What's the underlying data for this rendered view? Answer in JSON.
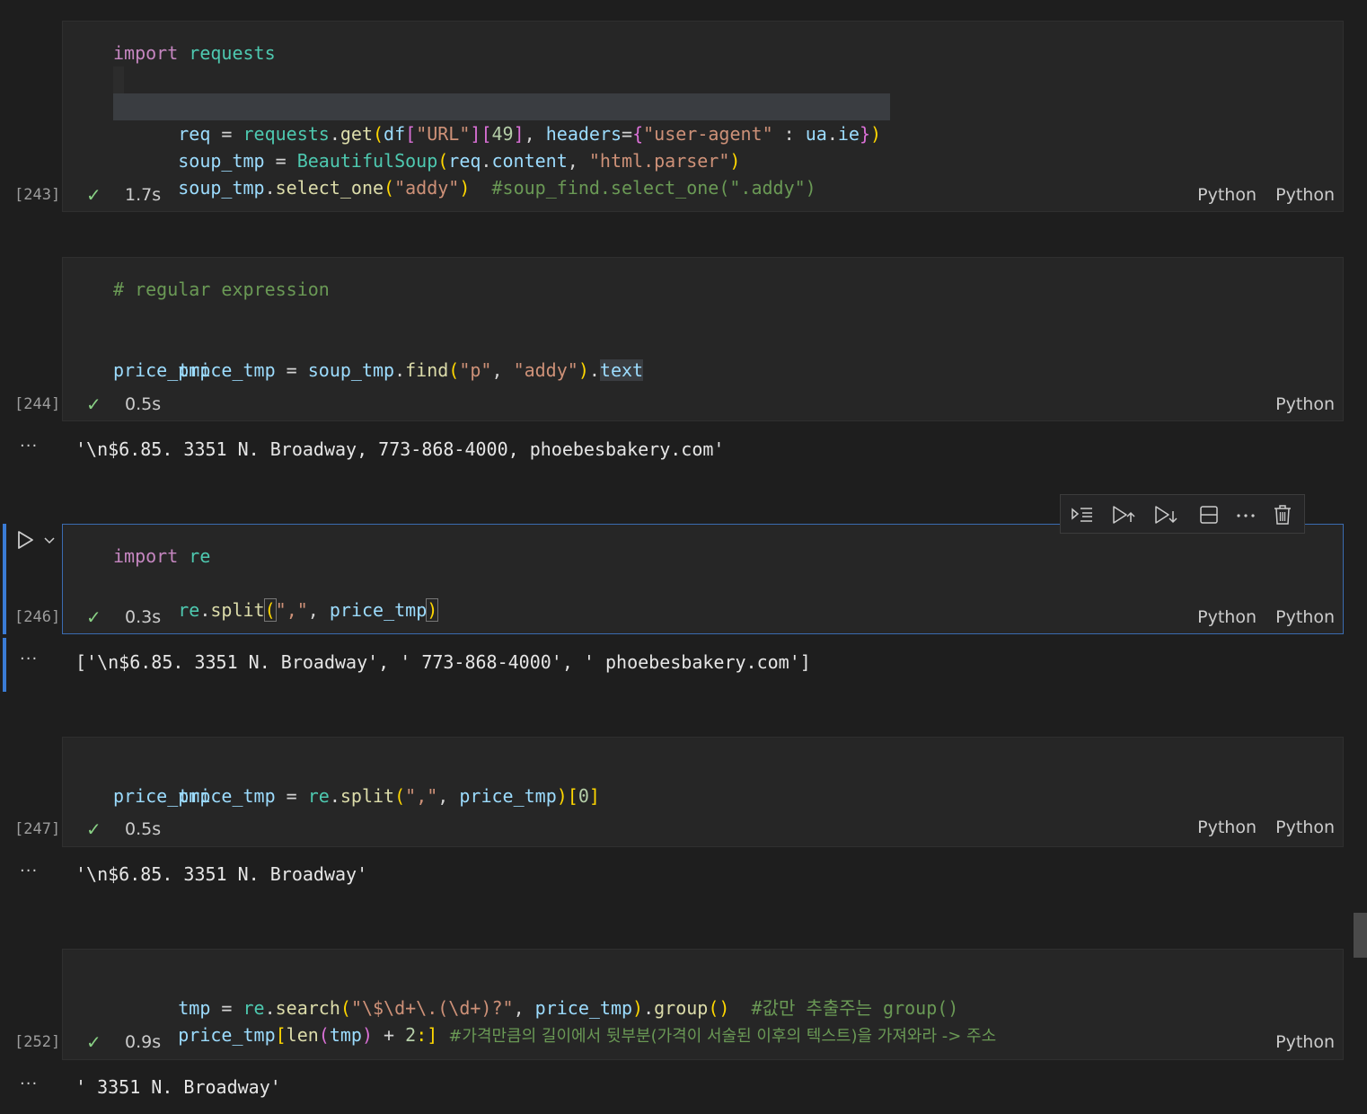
{
  "cells": [
    {
      "exec_count": "[243]",
      "status_icon": "check-icon",
      "duration": "1.7s",
      "lang_labels": [
        "Python",
        "Python"
      ]
    },
    {
      "exec_count": "[244]",
      "status_icon": "check-icon",
      "duration": "0.5s",
      "lang_labels": [
        "Python"
      ],
      "output": "'\\n$6.85. 3351 N. Broadway, 773-868-4000, phoebesbakery.com'"
    },
    {
      "exec_count": "[246]",
      "status_icon": "check-icon",
      "duration": "0.3s",
      "lang_labels": [
        "Python",
        "Python"
      ],
      "output": "['\\n$6.85. 3351 N. Broadway', ' 773-868-4000', ' phoebesbakery.com']"
    },
    {
      "exec_count": "[247]",
      "status_icon": "check-icon",
      "duration": "0.5s",
      "lang_labels": [
        "Python",
        "Python"
      ],
      "output": "'\\n$6.85. 3351 N. Broadway'"
    },
    {
      "exec_count": "[252]",
      "status_icon": "check-icon",
      "duration": "0.9s",
      "lang_labels": [
        "Python"
      ],
      "output": "' 3351 N. Broadway'"
    }
  ],
  "code": {
    "c0": {
      "l1a": "import",
      "l1b": "requests",
      "l3": [
        "req",
        " = ",
        "requests",
        ".",
        "get",
        "(",
        "df",
        "[",
        "\"URL\"",
        "]",
        "[",
        "49",
        "]",
        ", ",
        "headers",
        "=",
        "{",
        "\"user-agent\"",
        " : ",
        "ua",
        ".",
        "ie",
        "}",
        ")"
      ],
      "l4": [
        "soup_tmp",
        " = ",
        "BeautifulSoup",
        "(",
        "req",
        ".",
        "content",
        ", ",
        "\"html.parser\"",
        ")"
      ],
      "l5": [
        "soup_tmp",
        ".",
        "select_one",
        "(",
        "\"addy\"",
        ")",
        "  ",
        "#soup_find.select_one(\".addy\")"
      ]
    },
    "c1": {
      "l1": "# regular expression",
      "l3": [
        "price_tmp",
        " = ",
        "soup_tmp",
        ".",
        "find",
        "(",
        "\"p\"",
        ", ",
        "\"addy\"",
        ")",
        ".",
        "text"
      ],
      "l4": "price_tmp"
    },
    "c2": {
      "l1a": "import",
      "l1b": "re",
      "l2": [
        "re",
        ".",
        "split",
        "(",
        "\",\"",
        ", ",
        "price_tmp",
        ")"
      ]
    },
    "c3": {
      "l1": [
        "price_tmp",
        " = ",
        "re",
        ".",
        "split",
        "(",
        "\",\"",
        ", ",
        "price_tmp",
        ")",
        "[",
        "0",
        "]"
      ],
      "l2": "price_tmp"
    },
    "c4": {
      "l1": [
        "tmp",
        " = ",
        "re",
        ".",
        "search",
        "(",
        "\"\\$\\d+\\.(\\d+)?\"",
        ", ",
        "price_tmp",
        ")",
        ".",
        "group",
        "()",
        "  ",
        "#값만 추출주는 group()"
      ],
      "l2": [
        "price_tmp",
        "[",
        "len",
        "(",
        "tmp",
        ")",
        " + ",
        "2",
        ":]",
        " ",
        "#가격만큼의 길이에서 뒷부분(가격이 서술된 이후의 텍스트)을 가져와라 -> 주소"
      ]
    }
  },
  "toolbar": {
    "icons": [
      "run-by-line-icon",
      "execute-above-icon",
      "execute-below-icon",
      "split-cell-icon",
      "more-actions-icon",
      "delete-icon"
    ]
  },
  "sidebar_controls": {
    "run_icon": "run-cell-icon",
    "chevron_icon": "chevron-down-icon"
  },
  "colors": {
    "selection": "#3a7bd5",
    "success": "#89d185",
    "background": "#1e1e1e",
    "cell_background": "#262626"
  }
}
